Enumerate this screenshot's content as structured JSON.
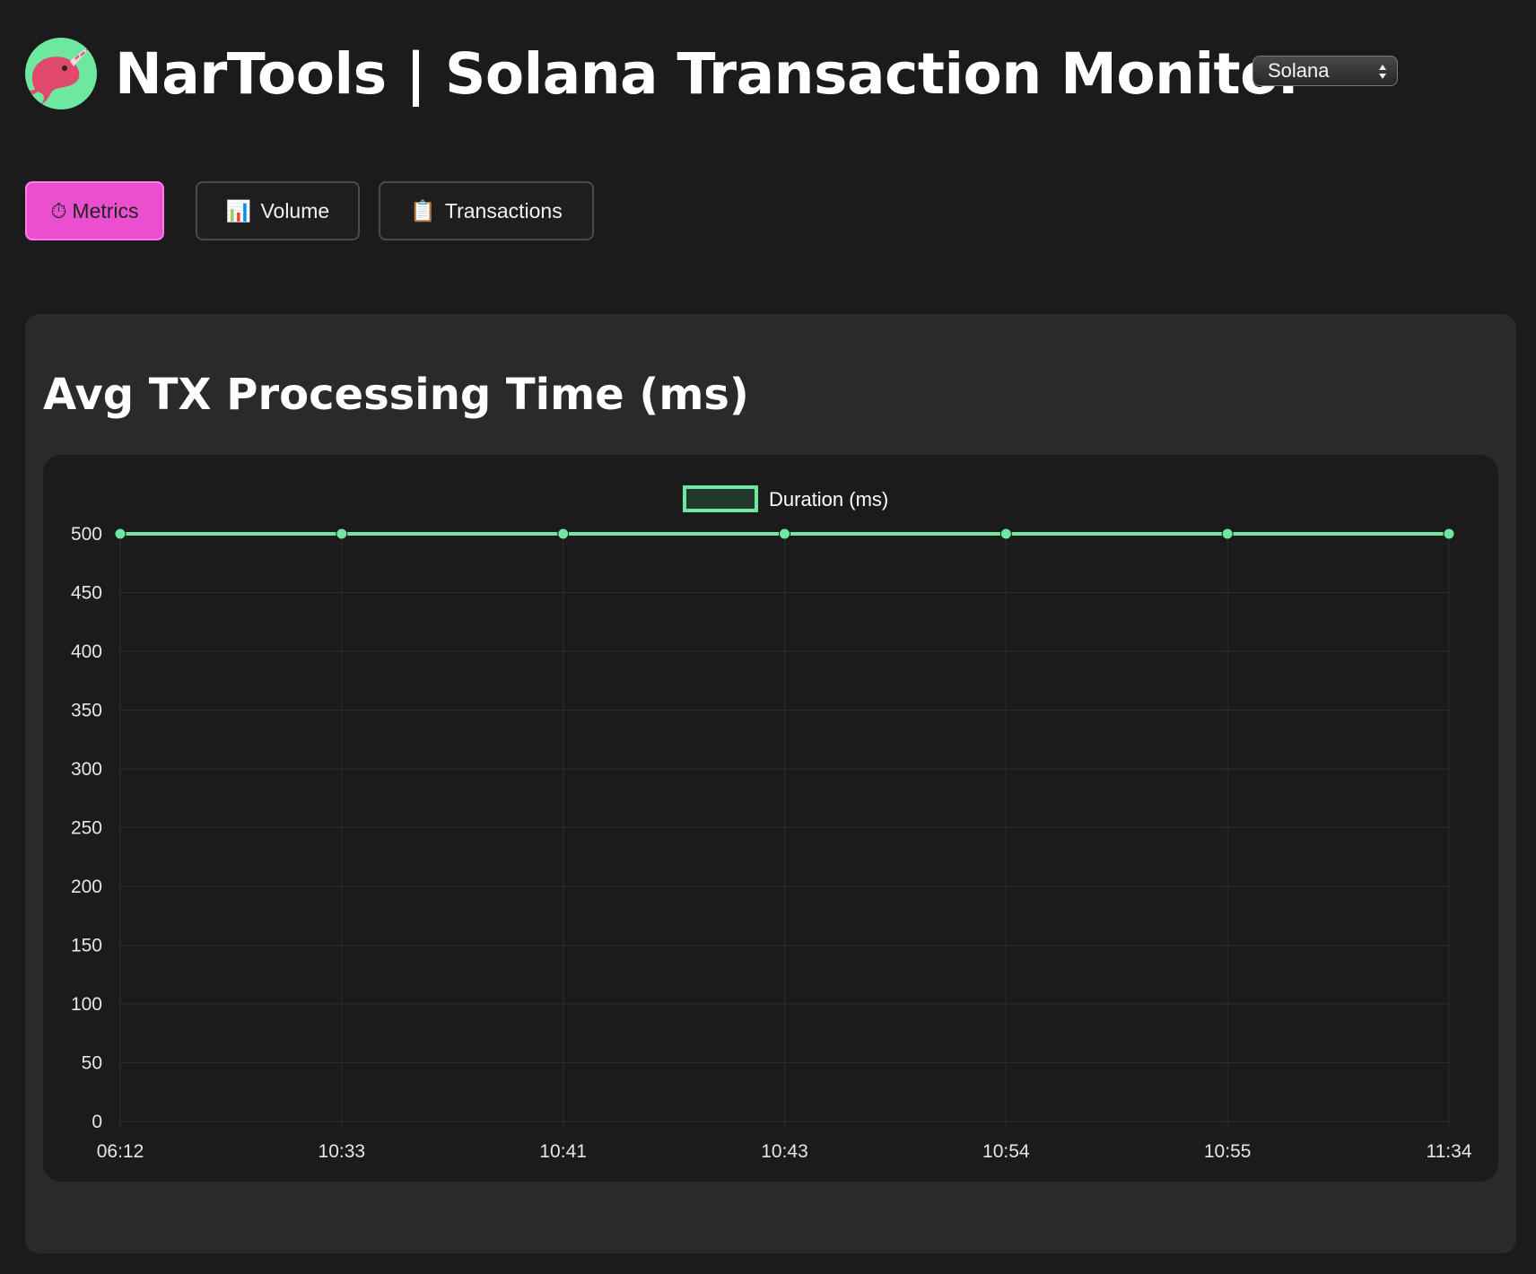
{
  "header": {
    "logo_icon": "narwhal-logo-icon",
    "title": "NarTools | Solana Transaction Monitor"
  },
  "network_select": {
    "selected": "Solana"
  },
  "tabs": [
    {
      "label": "Metrics",
      "icon": "⏱",
      "active": true
    },
    {
      "label": "Volume",
      "icon": "📊",
      "active": false
    },
    {
      "label": "Transactions",
      "icon": "📋",
      "active": false
    }
  ],
  "panel": {
    "title": "Avg TX Processing Time (ms)"
  },
  "colors": {
    "accent": "#ea4fd0",
    "series": "#6ee8a0",
    "background": "#1b1b1b",
    "panel": "#2a2a2a"
  },
  "chart_data": {
    "type": "line",
    "title": "",
    "xlabel": "",
    "ylabel": "",
    "categories": [
      "06:12",
      "10:33",
      "10:41",
      "10:43",
      "10:54",
      "10:55",
      "11:34"
    ],
    "series": [
      {
        "name": "Duration (ms)",
        "values": [
          500,
          500,
          500,
          500,
          500,
          500,
          500
        ]
      }
    ],
    "ylim": [
      0,
      500
    ],
    "yticks": [
      0,
      50,
      100,
      150,
      200,
      250,
      300,
      350,
      400,
      450,
      500
    ],
    "grid": true,
    "legend": "top-center"
  }
}
